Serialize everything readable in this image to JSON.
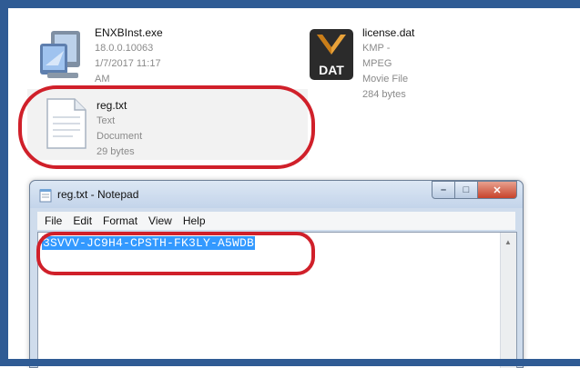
{
  "files": [
    {
      "name": "ENXBInst.exe",
      "meta1": "18.0.0.10063",
      "meta2": "1/7/2017 11:17 AM",
      "icon": "installer-icon"
    },
    {
      "name": "license.dat",
      "meta1": "KMP - MPEG Movie File",
      "meta2": "284 bytes",
      "icon": "dat-file-icon",
      "icon_label": "DAT"
    },
    {
      "name": "reg.txt",
      "meta1": "Text Document",
      "meta2": "29 bytes",
      "icon": "text-document-icon"
    }
  ],
  "notepad": {
    "title": "reg.txt - Notepad",
    "menu": [
      "File",
      "Edit",
      "Format",
      "View",
      "Help"
    ],
    "content": "3SVVV-JC9H4-CPSTH-FK3LY-A5WDB"
  },
  "colors": {
    "annotation": "#d0202a",
    "selection": "#3399ff",
    "frame": "#2f5b94"
  }
}
